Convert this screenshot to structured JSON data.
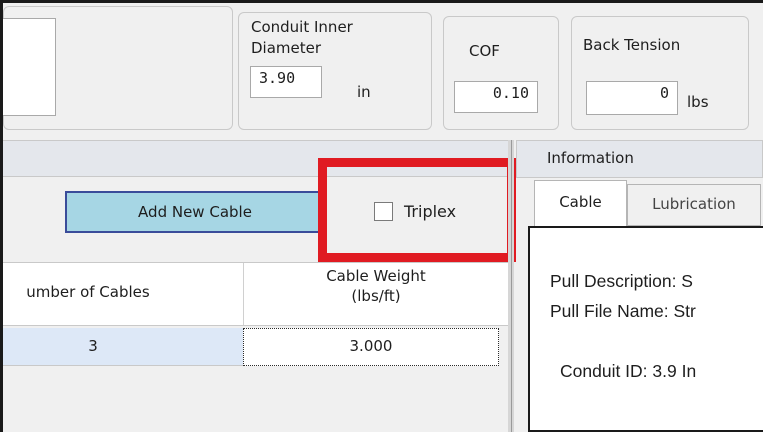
{
  "parameters": {
    "conduit_inner_diameter": {
      "label_line1": "Conduit Inner",
      "label_line2": "Diameter",
      "value": "3.90",
      "unit": "in"
    },
    "cof": {
      "label": "COF",
      "value": "0.10"
    },
    "back_tension": {
      "label": "Back Tension",
      "value": "0",
      "unit": "lbs"
    }
  },
  "cables_panel": {
    "add_button_label": "Add New Cable",
    "triplex_label": "Triplex",
    "triplex_checked": false,
    "columns": [
      {
        "header_line1": "umber of Cables",
        "header_line2": ""
      },
      {
        "header_line1": "Cable Weight",
        "header_line2": "(lbs/ft)"
      }
    ],
    "rows": [
      {
        "number_of_cables": "3",
        "cable_weight": "3.000"
      }
    ]
  },
  "information_panel": {
    "title": "Information",
    "tabs": [
      {
        "label": "Cable",
        "active": true
      },
      {
        "label": "Lubrication",
        "active": false
      }
    ],
    "lines": {
      "pull_description": "Pull Description: S",
      "pull_file_name": "Pull File Name: Str",
      "conduit_id": "Conduit ID: 3.9  In"
    }
  },
  "colors": {
    "highlight": "#e01b22",
    "button_fill": "#a6d6e4",
    "button_border": "#3a4c9a",
    "selected_row": "#dde8f7"
  }
}
